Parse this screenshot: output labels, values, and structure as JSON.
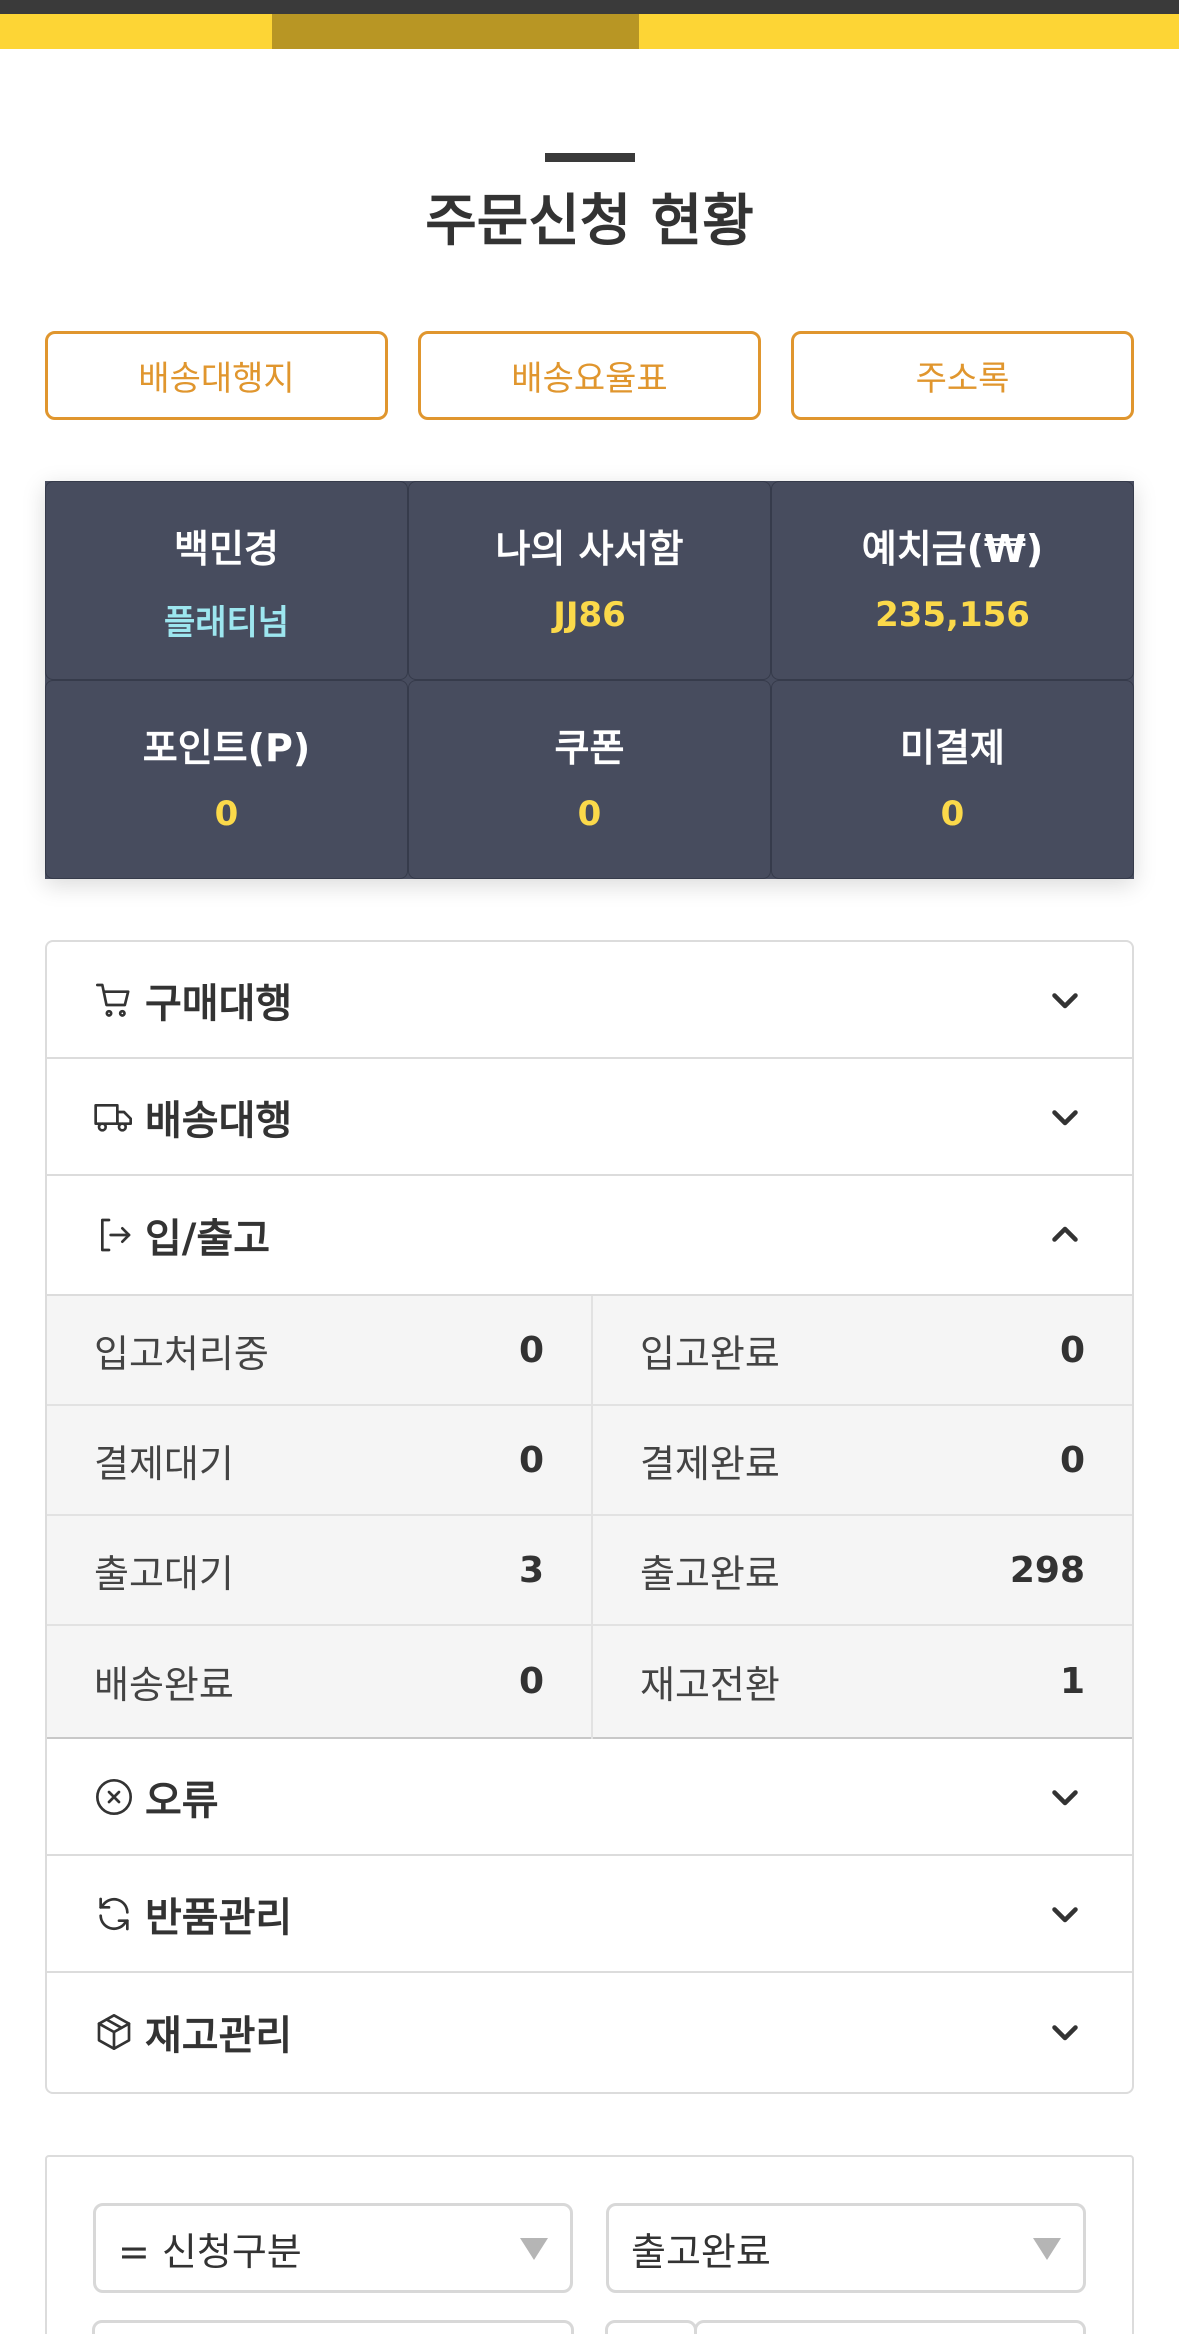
{
  "page": {
    "title": "주문신청 현황"
  },
  "quick_links": [
    {
      "label": "배송대행지"
    },
    {
      "label": "배송요율표"
    },
    {
      "label": "주소록"
    }
  ],
  "stats": [
    {
      "label": "백민경",
      "value": "플래티넘",
      "value_color": "#9de6ef"
    },
    {
      "label": "나의 사서함",
      "value": "JJ86",
      "value_color": "#fbd94a"
    },
    {
      "label": "예치금(₩)",
      "value": "235,156",
      "value_color": "#fbd94a"
    },
    {
      "label": "포인트(P)",
      "value": "0",
      "value_color": "#fbd94a"
    },
    {
      "label": "쿠폰",
      "value": "0",
      "value_color": "#fbd94a"
    },
    {
      "label": "미결제",
      "value": "0",
      "value_color": "#fbd94a"
    }
  ],
  "accordion": [
    {
      "label": "구매대행",
      "icon": "cart-icon",
      "expanded": false
    },
    {
      "label": "배송대행",
      "icon": "truck-icon",
      "expanded": false
    },
    {
      "label": "입/출고",
      "icon": "sign-in-icon",
      "expanded": true
    },
    {
      "label": "오류",
      "icon": "x-circle-icon",
      "expanded": false
    },
    {
      "label": "반품관리",
      "icon": "refresh-icon",
      "expanded": false
    },
    {
      "label": "재고관리",
      "icon": "box-icon",
      "expanded": false
    }
  ],
  "inout_status": [
    {
      "label": "입고처리중",
      "value": "0"
    },
    {
      "label": "입고완료",
      "value": "0"
    },
    {
      "label": "결제대기",
      "value": "0"
    },
    {
      "label": "결제완료",
      "value": "0"
    },
    {
      "label": "출고대기",
      "value": "3"
    },
    {
      "label": "출고완료",
      "value": "298"
    },
    {
      "label": "배송완료",
      "value": "0"
    },
    {
      "label": "재고전환",
      "value": "1"
    }
  ],
  "filters": {
    "type_select": "= 신청구분",
    "status_select": "출고완료"
  },
  "colors": {
    "brand_yellow": "#fdd535",
    "accent_orange": "#e0962e",
    "stats_bg": "#474c5e"
  }
}
